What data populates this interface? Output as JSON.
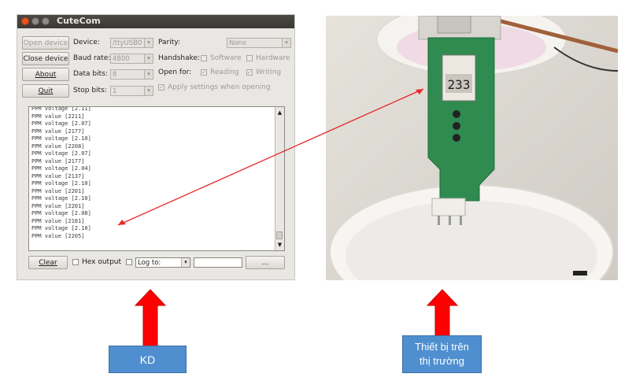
{
  "window": {
    "title": "CuteCom",
    "buttons": {
      "open_device": "Open device",
      "close_device": "Close device",
      "about": "About",
      "quit": "Quit",
      "clear": "Clear",
      "browse": "..."
    },
    "labels": {
      "device": "Device:",
      "baud_rate": "Baud rate:",
      "data_bits": "Data bits:",
      "stop_bits": "Stop bits:",
      "parity": "Parity:",
      "handshake": "Handshake:",
      "software": "Software",
      "hardware": "Hardware",
      "open_for": "Open for:",
      "reading": "Reading",
      "writing": "Writing",
      "apply_settings": "Apply settings when opening",
      "hex_output": "Hex output"
    },
    "values": {
      "device": "/ttyUSB0",
      "baud_rate": "4800",
      "data_bits": "8",
      "stop_bits": "1",
      "parity": "None",
      "log_to": "Log to:",
      "log_file": ""
    },
    "checks": {
      "software": false,
      "hardware": false,
      "reading": true,
      "writing": true,
      "apply_settings": true,
      "hex_output": false,
      "log_to": false
    },
    "output_lines": [
      "PPM voltage [2.11]",
      "PPM value [2211]",
      "PPM voltage [2.07]",
      "PPM value [2177]",
      "PPM voltage [2.10]",
      "PPM value [2208]",
      "PPM voltage [2.07]",
      "PPM value [2177]",
      "PPM voltage [2.04]",
      "PPM value [2137]",
      "PPM voltage [2.10]",
      "PPM value [2201]",
      "PPM voltage [2.10]",
      "PPM value [2201]",
      "PPM voltage [2.08]",
      "PPM value [2181]",
      "PPM voltage [2.10]",
      "PPM value [2205]"
    ]
  },
  "photo": {
    "display_reading": "233"
  },
  "callouts": {
    "left": "KD",
    "right_line1": "Thiết bị trên",
    "right_line2": "thị trường"
  },
  "colors": {
    "arrow_red": "#ff0000",
    "callout_blue": "#4f8fd0",
    "pointer_red": "#e8282b"
  }
}
